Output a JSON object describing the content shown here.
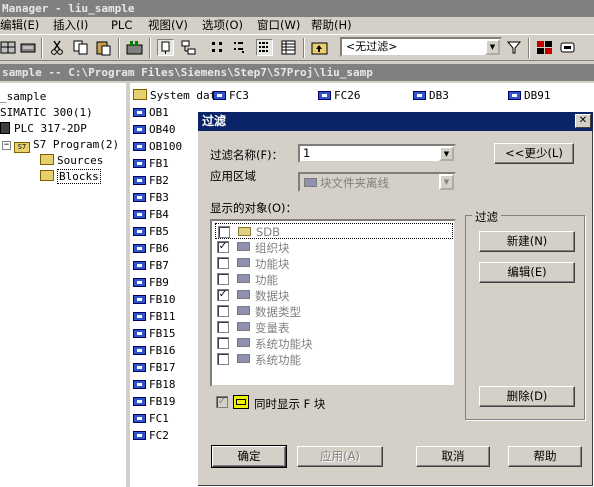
{
  "window_title": "Manager - liu_sample",
  "menu": [
    {
      "label": "编辑(E)"
    },
    {
      "label": "插入(I)"
    },
    {
      "label": "PLC"
    },
    {
      "label": "视图(V)"
    },
    {
      "label": "选项(O)"
    },
    {
      "label": "窗口(W)"
    },
    {
      "label": "帮助(H)"
    }
  ],
  "toolbar": {
    "filter_value": "<无过滤>"
  },
  "project_window_title": "sample -- C:\\Program Files\\Siemens\\Step7\\S7Proj\\liu_samp",
  "tree": [
    {
      "label": "_sample"
    },
    {
      "label": "SIMATIC 300(1)"
    },
    {
      "label": "PLC 317-2DP"
    },
    {
      "label": "S7 Program(2)"
    },
    {
      "label": "Sources"
    },
    {
      "label": "Blocks"
    }
  ],
  "blocks_col1": [
    "System data",
    "OB1",
    "OB40",
    "OB100",
    "FB1",
    "FB2",
    "FB3",
    "FB4",
    "FB5",
    "FB6",
    "FB7",
    "FB9",
    "FB10",
    "FB11",
    "FB15",
    "FB16",
    "FB17",
    "FB18",
    "FB19",
    "FC1",
    "FC2"
  ],
  "blocks_top": [
    "FC3",
    "FC26",
    "DB3",
    "DB91"
  ],
  "dialog": {
    "title": "过滤",
    "filter_name_label": "过滤名称(F)：",
    "filter_name_value": "1",
    "area_label": "应用区域",
    "area_value": "块文件夹离线",
    "objects_label": "显示的对象(O)：",
    "objects": [
      {
        "label": "SDB",
        "checked": false
      },
      {
        "label": "组织块",
        "checked": true
      },
      {
        "label": "功能块",
        "checked": false
      },
      {
        "label": "功能",
        "checked": false
      },
      {
        "label": "数据块",
        "checked": true
      },
      {
        "label": "数据类型",
        "checked": false
      },
      {
        "label": "变量表",
        "checked": false
      },
      {
        "label": "系统功能块",
        "checked": false
      },
      {
        "label": "系统功能",
        "checked": false
      }
    ],
    "less_button": "<<更少(L)",
    "group_label": "过滤",
    "new_button": "新建(N)",
    "edit_button": "编辑(E)",
    "delete_button": "删除(D)",
    "show_f_label": "同时显示 F 块",
    "ok_button": "确定",
    "apply_button": "应用(A)",
    "cancel_button": "取消",
    "help_button": "帮助"
  }
}
